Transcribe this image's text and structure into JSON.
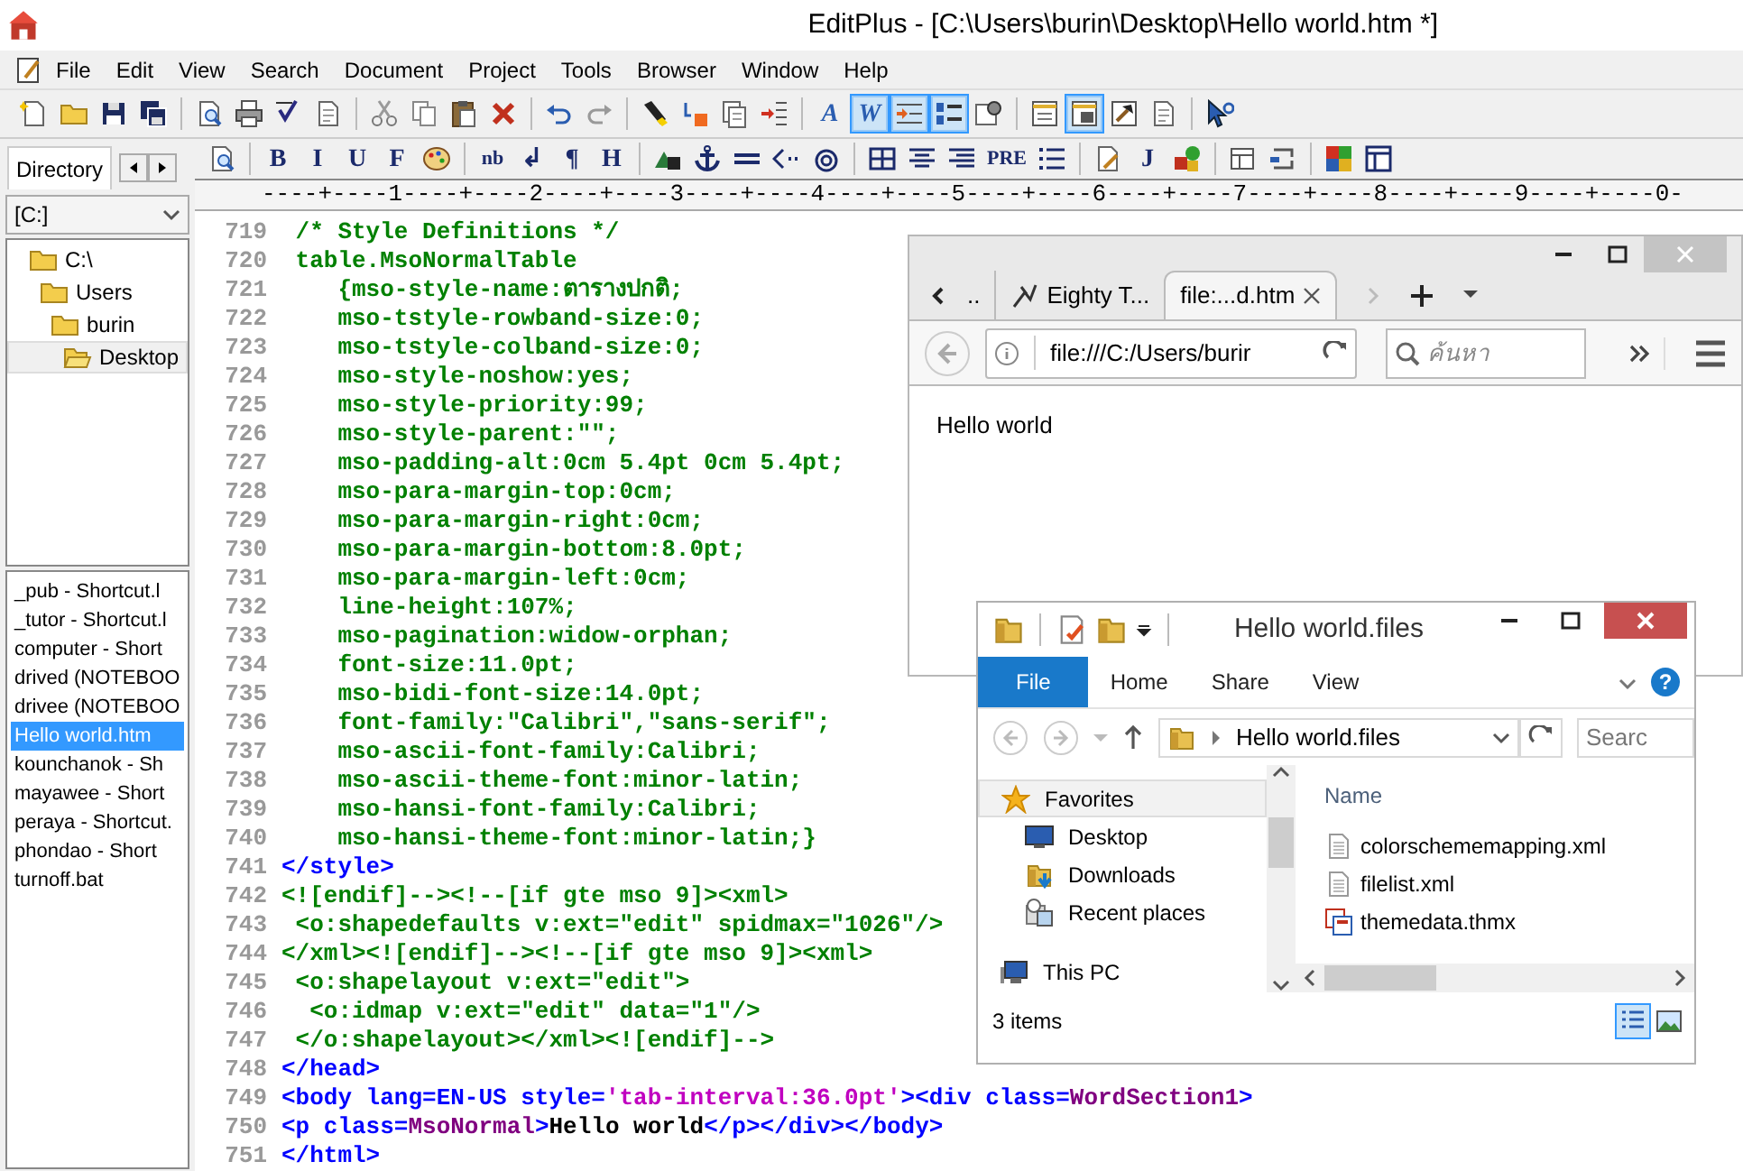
{
  "window": {
    "title": "EditPlus - [C:\\Users\\burin\\Desktop\\Hello world.htm *]"
  },
  "menu": [
    "File",
    "Edit",
    "View",
    "Search",
    "Document",
    "Project",
    "Tools",
    "Browser",
    "Window",
    "Help"
  ],
  "toolbar_main": [
    {
      "kind": "newdoc",
      "pressed": false
    },
    {
      "kind": "folder",
      "pressed": false
    },
    {
      "kind": "floppy",
      "pressed": false
    },
    {
      "kind": "floppies",
      "pressed": false
    },
    {
      "kind": "separator"
    },
    {
      "kind": "preview",
      "pressed": false
    },
    {
      "kind": "printer",
      "pressed": false
    },
    {
      "kind": "spellcheck",
      "pressed": false
    },
    {
      "kind": "document",
      "pressed": false
    },
    {
      "kind": "separator"
    },
    {
      "kind": "scissors",
      "pressed": false
    },
    {
      "kind": "copy",
      "pressed": false
    },
    {
      "kind": "clipboard",
      "pressed": false
    },
    {
      "kind": "cross",
      "pressed": false
    },
    {
      "kind": "separator"
    },
    {
      "kind": "undo",
      "pressed": false
    },
    {
      "kind": "redo",
      "pressed": false
    },
    {
      "kind": "separator"
    },
    {
      "kind": "highlighter",
      "pressed": false
    },
    {
      "kind": "replace",
      "pressed": false
    },
    {
      "kind": "pages",
      "pressed": false
    },
    {
      "kind": "indent",
      "pressed": false
    },
    {
      "kind": "separator"
    },
    {
      "kind": "glyph",
      "label": "A",
      "pressed": false
    },
    {
      "kind": "glyph",
      "label": "W",
      "pressed": true
    },
    {
      "kind": "wrap",
      "pressed": true
    },
    {
      "kind": "numbers",
      "pressed": true
    },
    {
      "kind": "settings",
      "pressed": false
    },
    {
      "kind": "separator"
    },
    {
      "kind": "listwindow",
      "pressed": false
    },
    {
      "kind": "window",
      "pressed": true
    },
    {
      "kind": "hammer",
      "pressed": false
    },
    {
      "kind": "document",
      "pressed": false
    },
    {
      "kind": "separator"
    },
    {
      "kind": "cursor",
      "pressed": false
    }
  ],
  "toolbar_html": [
    {
      "kind": "preview"
    },
    {
      "kind": "separator"
    },
    {
      "kind": "glyph",
      "label": "B"
    },
    {
      "kind": "glyph",
      "label": "I"
    },
    {
      "kind": "glyph",
      "label": "U"
    },
    {
      "kind": "glyph",
      "label": "F"
    },
    {
      "kind": "palette"
    },
    {
      "kind": "separator"
    },
    {
      "kind": "glyph",
      "label": "nb"
    },
    {
      "kind": "glyph",
      "label": "↲"
    },
    {
      "kind": "glyph",
      "label": "¶"
    },
    {
      "kind": "glyph",
      "label": "H"
    },
    {
      "kind": "separator"
    },
    {
      "kind": "shapes"
    },
    {
      "kind": "anchor"
    },
    {
      "kind": "hrule"
    },
    {
      "kind": "comment"
    },
    {
      "kind": "target"
    },
    {
      "kind": "separator"
    },
    {
      "kind": "table"
    },
    {
      "kind": "center"
    },
    {
      "kind": "right"
    },
    {
      "kind": "glyph",
      "label": "PRE"
    },
    {
      "kind": "list"
    },
    {
      "kind": "separator"
    },
    {
      "kind": "script"
    },
    {
      "kind": "glyph",
      "label": "J"
    },
    {
      "kind": "blocks"
    },
    {
      "kind": "separator"
    },
    {
      "kind": "frame"
    },
    {
      "kind": "frames"
    },
    {
      "kind": "separator"
    },
    {
      "kind": "colorgrid"
    },
    {
      "kind": "layout"
    }
  ],
  "directory_panel": {
    "tabs": [
      {
        "label": "Directory",
        "selected": true
      }
    ],
    "drive": "[C:]",
    "folders": [
      {
        "label": "C:\\",
        "selected": false,
        "children": [
          {
            "label": "Users",
            "selected": false,
            "children": [
              {
                "label": "burin",
                "selected": false,
                "children": [
                  {
                    "label": "Desktop",
                    "selected": true
                  }
                ]
              }
            ]
          }
        ]
      }
    ],
    "files": [
      {
        "label": "_pub - Shortcut.l",
        "selected": false
      },
      {
        "label": "_tutor - Shortcut.l",
        "selected": false
      },
      {
        "label": "computer - Short",
        "selected": false
      },
      {
        "label": "drived (NOTEBOO",
        "selected": false
      },
      {
        "label": "drivee (NOTEBOO",
        "selected": false
      },
      {
        "label": "Hello world.htm",
        "selected": true
      },
      {
        "label": "kounchanok - Sh",
        "selected": false
      },
      {
        "label": "mayawee - Short",
        "selected": false
      },
      {
        "label": "peraya - Shortcut.",
        "selected": false
      },
      {
        "label": "phondao - Short",
        "selected": false
      },
      {
        "label": "turnoff.bat",
        "selected": false
      }
    ]
  },
  "ruler": "----+----1----+----2----+----3----+----4----+----5----+----6----+----7----+----8----+----9----+----0-",
  "code_lines": [
    {
      "number": "719",
      "segments": [
        {
          "kind": "css",
          "text": " /* Style Definitions */"
        }
      ]
    },
    {
      "number": "720",
      "segments": [
        {
          "kind": "css",
          "text": " table.MsoNormalTable"
        }
      ]
    },
    {
      "number": "721",
      "segments": [
        {
          "kind": "css",
          "text": "    {mso-style-name:ตารางปกติ;"
        }
      ]
    },
    {
      "number": "722",
      "segments": [
        {
          "kind": "css",
          "text": "    mso-tstyle-rowband-size:0;"
        }
      ]
    },
    {
      "number": "723",
      "segments": [
        {
          "kind": "css",
          "text": "    mso-tstyle-colband-size:0;"
        }
      ]
    },
    {
      "number": "724",
      "segments": [
        {
          "kind": "css",
          "text": "    mso-style-noshow:yes;"
        }
      ]
    },
    {
      "number": "725",
      "segments": [
        {
          "kind": "css",
          "text": "    mso-style-priority:99;"
        }
      ]
    },
    {
      "number": "726",
      "segments": [
        {
          "kind": "css",
          "text": "    mso-style-parent:\"\";"
        }
      ]
    },
    {
      "number": "727",
      "segments": [
        {
          "kind": "css",
          "text": "    mso-padding-alt:0cm 5.4pt 0cm 5.4pt;"
        }
      ]
    },
    {
      "number": "728",
      "segments": [
        {
          "kind": "css",
          "text": "    mso-para-margin-top:0cm;"
        }
      ]
    },
    {
      "number": "729",
      "segments": [
        {
          "kind": "css",
          "text": "    mso-para-margin-right:0cm;"
        }
      ]
    },
    {
      "number": "730",
      "segments": [
        {
          "kind": "css",
          "text": "    mso-para-margin-bottom:8.0pt;"
        }
      ]
    },
    {
      "number": "731",
      "segments": [
        {
          "kind": "css",
          "text": "    mso-para-margin-left:0cm;"
        }
      ]
    },
    {
      "number": "732",
      "segments": [
        {
          "kind": "css",
          "text": "    line-height:107%;"
        }
      ]
    },
    {
      "number": "733",
      "segments": [
        {
          "kind": "css",
          "text": "    mso-pagination:widow-orphan;"
        }
      ]
    },
    {
      "number": "734",
      "segments": [
        {
          "kind": "css",
          "text": "    font-size:11.0pt;"
        }
      ]
    },
    {
      "number": "735",
      "segments": [
        {
          "kind": "css",
          "text": "    mso-bidi-font-size:14.0pt;"
        }
      ]
    },
    {
      "number": "736",
      "segments": [
        {
          "kind": "css",
          "text": "    font-family:\"Calibri\",\"sans-serif\";"
        }
      ]
    },
    {
      "number": "737",
      "segments": [
        {
          "kind": "css",
          "text": "    mso-ascii-font-family:Calibri;"
        }
      ]
    },
    {
      "number": "738",
      "segments": [
        {
          "kind": "css",
          "text": "    mso-ascii-theme-font:minor-latin;"
        }
      ]
    },
    {
      "number": "739",
      "segments": [
        {
          "kind": "css",
          "text": "    mso-hansi-font-family:Calibri;"
        }
      ]
    },
    {
      "number": "740",
      "segments": [
        {
          "kind": "css",
          "text": "    mso-hansi-theme-font:minor-latin;}"
        }
      ]
    },
    {
      "number": "741",
      "segments": [
        {
          "kind": "tag",
          "text": "</style>"
        }
      ]
    },
    {
      "number": "742",
      "segments": [
        {
          "kind": "xml",
          "text": "<![endif]--><!--[if gte mso 9]><xml>"
        }
      ]
    },
    {
      "number": "743",
      "segments": [
        {
          "kind": "xml",
          "text": " <o:shapedefaults v:ext=\"edit\" spidmax=\"1026\"/>"
        }
      ]
    },
    {
      "number": "744",
      "segments": [
        {
          "kind": "xml",
          "text": "</xml><![endif]--><!--[if gte mso 9]><xml>"
        }
      ]
    },
    {
      "number": "745",
      "segments": [
        {
          "kind": "xml",
          "text": " <o:shapelayout v:ext=\"edit\">"
        }
      ]
    },
    {
      "number": "746",
      "segments": [
        {
          "kind": "xml",
          "text": "  <o:idmap v:ext=\"edit\" data=\"1\"/>"
        }
      ]
    },
    {
      "number": "747",
      "segments": [
        {
          "kind": "xml",
          "text": " </o:shapelayout></xml><![endif]-->"
        }
      ]
    },
    {
      "number": "748",
      "segments": [
        {
          "kind": "tag",
          "text": "</head>"
        }
      ]
    },
    {
      "number": "749",
      "segments": [
        {
          "kind": "tag",
          "text": "<body lang=EN-US style="
        },
        {
          "kind": "value",
          "text": "'tab-interval:36.0pt'"
        },
        {
          "kind": "tag",
          "text": "><div class="
        },
        {
          "kind": "attr",
          "text": "WordSection1"
        },
        {
          "kind": "tag",
          "text": ">"
        }
      ]
    },
    {
      "number": "750",
      "segments": [
        {
          "kind": "tag",
          "text": "<p class="
        },
        {
          "kind": "attr",
          "text": "MsoNormal"
        },
        {
          "kind": "tag",
          "text": ">"
        },
        {
          "kind": "text",
          "text": "Hello world"
        },
        {
          "kind": "tag",
          "text": "</p></div></body>"
        }
      ]
    },
    {
      "number": "751",
      "segments": [
        {
          "kind": "tag",
          "text": "</html>"
        }
      ]
    }
  ],
  "browser": {
    "tabs": [
      {
        "label": "..",
        "selected": false
      },
      {
        "label": "Eighty T...",
        "selected": false
      },
      {
        "label": "file:...d.htm",
        "selected": true
      }
    ],
    "address": "file:///C:/Users/burir",
    "search": {
      "placeholder": "ค้นหา"
    },
    "page_text": "Hello world"
  },
  "explorer": {
    "title": "Hello world.files",
    "ribbon_tabs": [
      {
        "label": "File",
        "selected": true
      },
      {
        "label": "Home",
        "selected": false
      },
      {
        "label": "Share",
        "selected": false
      },
      {
        "label": "View",
        "selected": false
      }
    ],
    "help": "?",
    "address": "Hello world.files",
    "search": {
      "placeholder": "Searc"
    },
    "navigation": [
      {
        "label": "Favorites",
        "kind": "star",
        "selected": true
      },
      {
        "label": "Desktop",
        "kind": "desktop",
        "selected": false
      },
      {
        "label": "Downloads",
        "kind": "downloads",
        "selected": false
      },
      {
        "label": "Recent places",
        "kind": "recent",
        "selected": false
      },
      {
        "label": "This PC",
        "kind": "computer",
        "selected": false
      }
    ],
    "column": "Name",
    "files": [
      {
        "label": "colorschememapping.xml",
        "kind": "text"
      },
      {
        "label": "filelist.xml",
        "kind": "text"
      },
      {
        "label": "themedata.thmx",
        "kind": "theme"
      }
    ],
    "status": "3 items",
    "view_buttons": [
      {
        "kind": "details",
        "selected": true
      },
      {
        "kind": "preview",
        "selected": false
      }
    ]
  }
}
